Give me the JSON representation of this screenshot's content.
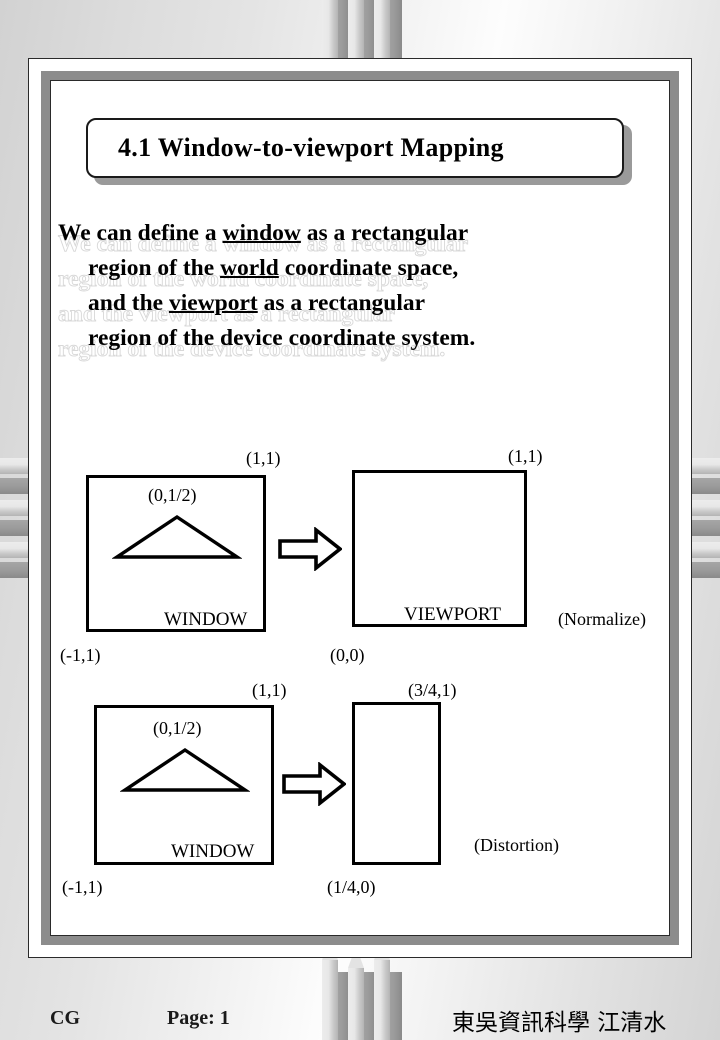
{
  "slide": {
    "title": "4.1  Window-to-viewport Mapping",
    "body": {
      "line1_a": "We can define a ",
      "line1_u": "window",
      "line1_b": " as a rectangular",
      "line1_full": "We can define a window as a rectangular",
      "line2_a": "region  of  the  ",
      "line2_u": "world",
      "line2_b": "  coordinate  space,",
      "line2_full": "region  of  the  world  coordinate  space,",
      "line3_a": "and  the  ",
      "line3_u": "viewport",
      "line3_b": "  as  a   rectangular",
      "line3_full": "and  the  viewport  as  a   rectangular",
      "line4_full": "region of the  device  coordinate  system."
    }
  },
  "diagrams": {
    "row1": {
      "window": {
        "name": "WINDOW",
        "top_right": "(1,1)",
        "bottom_left": "(-1,1)",
        "apex": "(0,1/2)"
      },
      "viewport": {
        "name": "VIEWPORT",
        "top_right": "(1,1)",
        "bottom_left": "(0,0)"
      },
      "note": "(Normalize)"
    },
    "row2": {
      "window": {
        "name": "WINDOW",
        "top_right": "(1,1)",
        "bottom_left": "(-1,1)",
        "apex": "(0,1/2)"
      },
      "viewport": {
        "top_right": "(3/4,1)",
        "bottom_left": "(1/4,0)"
      },
      "note": "(Distortion)"
    }
  },
  "footer": {
    "course": "CG",
    "page": "Page: 1",
    "department": "東吳資訊科學  江清水"
  },
  "colors": {
    "ink": "#000000",
    "frame_band": "#8c8c8c",
    "frame_line": "#2a2a2a",
    "shadow": "#9a9a9a",
    "ghost": "#d8d8d8"
  }
}
